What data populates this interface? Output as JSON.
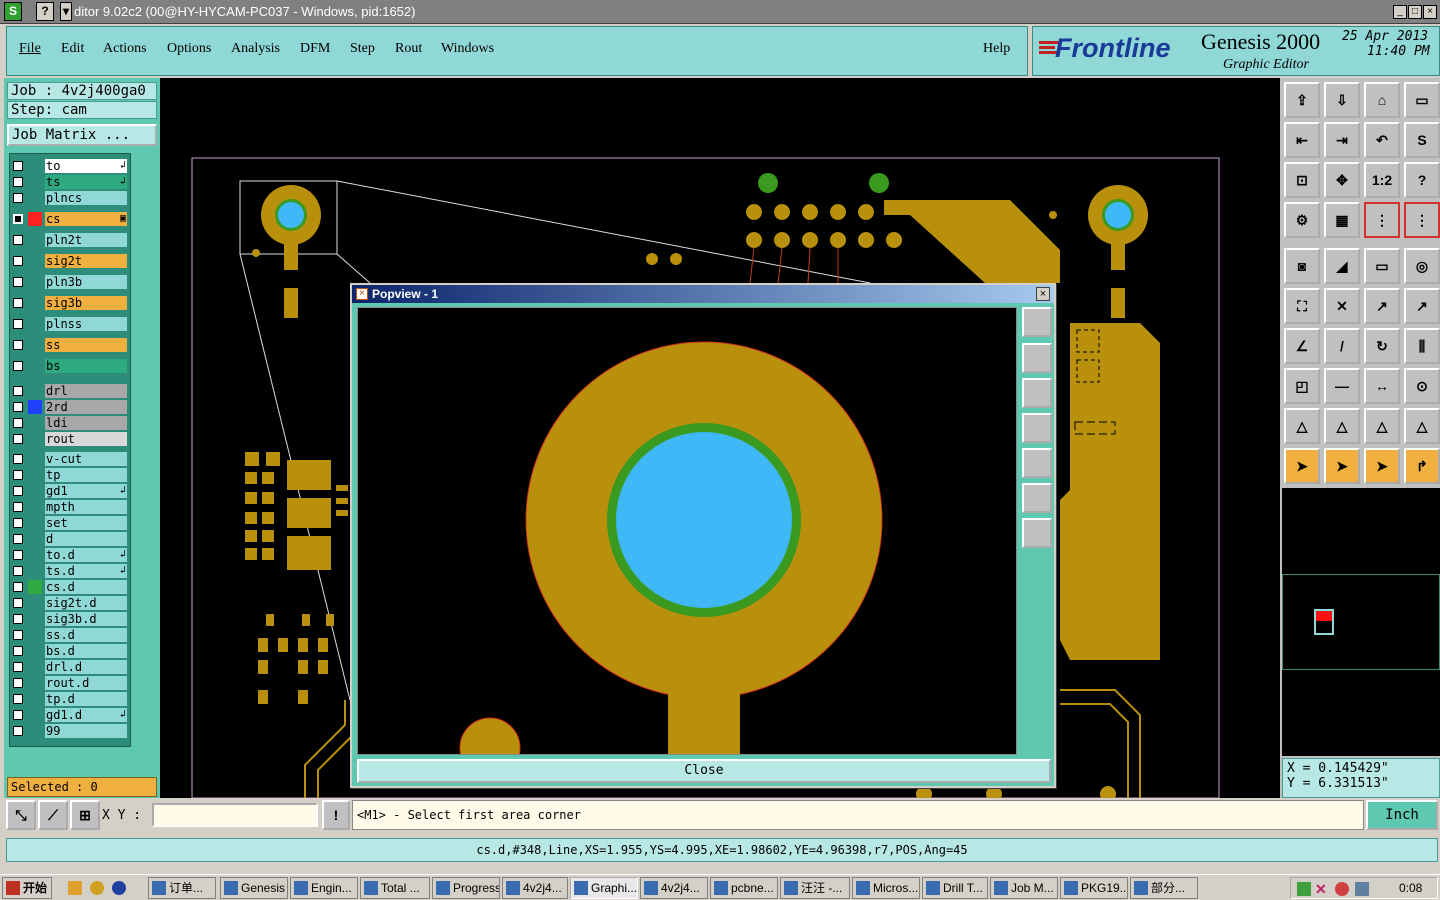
{
  "window": {
    "title": "ditor 9.02c2 (00@HY-HYCAM-PC037 - Windows, pid:1652)",
    "icon_s": "S",
    "icon_q": "?",
    "min": "_",
    "max": "□",
    "close": "×"
  },
  "menu": [
    "File",
    "Edit",
    "Actions",
    "Options",
    "Analysis",
    "DFM",
    "Step",
    "Rout",
    "Windows"
  ],
  "help": "Help",
  "brand": {
    "logo": "Frontline",
    "product": "Genesis 2000",
    "sub": "Graphic Editor",
    "date": "25 Apr 2013",
    "time": "11:40 PM"
  },
  "job": {
    "job": "Job : 4v2j400ga0",
    "step": "Step: cam",
    "matrix": "Job Matrix ..."
  },
  "layers": [
    {
      "name": "to",
      "bg": "#ffffff",
      "sw": "",
      "mark": "↲"
    },
    {
      "name": "ts",
      "bg": "#2eaa80",
      "sw": "",
      "mark": "↲"
    },
    {
      "name": "plncs",
      "bg": "#8fd8d6",
      "sw": ""
    },
    {
      "name": "cs",
      "bg": "#f0b040",
      "sw": "#ff2020",
      "mark": "▣",
      "sel": true
    },
    {
      "name": "pln2t",
      "bg": "#8fd8d6",
      "sw": ""
    },
    {
      "name": "sig2t",
      "bg": "#f0b040",
      "sw": ""
    },
    {
      "name": "pln3b",
      "bg": "#8fd8d6",
      "sw": ""
    },
    {
      "name": "sig3b",
      "bg": "#f0b040",
      "sw": ""
    },
    {
      "name": "plnss",
      "bg": "#8fd8d6",
      "sw": ""
    },
    {
      "name": "ss",
      "bg": "#f0b040",
      "sw": ""
    },
    {
      "name": "bs",
      "bg": "#2eaa80",
      "sw": ""
    },
    {
      "name": "drl",
      "bg": "#a8a8a8",
      "sw": ""
    },
    {
      "name": "2rd",
      "bg": "#a8a8a8",
      "sw": "#2040ff"
    },
    {
      "name": "ldi",
      "bg": "#a8a8a8",
      "sw": ""
    },
    {
      "name": "rout",
      "bg": "#d8d8d8",
      "sw": ""
    },
    {
      "name": "v-cut",
      "bg": "#8fd8d6",
      "sw": ""
    },
    {
      "name": "tp",
      "bg": "#8fd8d6",
      "sw": ""
    },
    {
      "name": "gd1",
      "bg": "#8fd8d6",
      "sw": "",
      "mark": "↲"
    },
    {
      "name": "mpth",
      "bg": "#8fd8d6",
      "sw": ""
    },
    {
      "name": "set",
      "bg": "#8fd8d6",
      "sw": ""
    },
    {
      "name": "d",
      "bg": "#8fd8d6",
      "sw": ""
    },
    {
      "name": "to.d",
      "bg": "#8fd8d6",
      "sw": "",
      "mark": "↲"
    },
    {
      "name": "ts.d",
      "bg": "#8fd8d6",
      "sw": "",
      "mark": "↲"
    },
    {
      "name": "cs.d",
      "bg": "#8fd8d6",
      "sw": "#2eaa40"
    },
    {
      "name": "sig2t.d",
      "bg": "#8fd8d6",
      "sw": ""
    },
    {
      "name": "sig3b.d",
      "bg": "#8fd8d6",
      "sw": ""
    },
    {
      "name": "ss.d",
      "bg": "#8fd8d6",
      "sw": ""
    },
    {
      "name": "bs.d",
      "bg": "#8fd8d6",
      "sw": ""
    },
    {
      "name": "drl.d",
      "bg": "#8fd8d6",
      "sw": ""
    },
    {
      "name": "rout.d",
      "bg": "#8fd8d6",
      "sw": ""
    },
    {
      "name": "tp.d",
      "bg": "#8fd8d6",
      "sw": ""
    },
    {
      "name": "gd1.d",
      "bg": "#8fd8d6",
      "sw": "",
      "mark": "↲"
    },
    {
      "name": "99",
      "bg": "#8fd8d6",
      "sw": ""
    }
  ],
  "selected": "Selected : 0",
  "popview": {
    "title": "Popview - 1",
    "close_btn": "Close",
    "close_x": "×"
  },
  "coords": {
    "x": "X = 0.145429\"",
    "y": "Y = 6.331513\""
  },
  "cmd": {
    "xy_label": "X Y :",
    "prompt": "<M1> - Select first area corner",
    "unit": "Inch",
    "bang": "!"
  },
  "status": "cs.d,#348,Line,XS=1.955,YS=4.995,XE=1.98602,YE=4.96398,r7,POS,Ang=45",
  "taskbar": {
    "start": "开始",
    "clock": "0:08",
    "tasks": [
      "订单...",
      "Genesis",
      "Engin...",
      "Total ...",
      "Progress",
      "4v2j4...",
      "Graphi...",
      "4v2j4...",
      "pcbne...",
      "汪汪 -...",
      "Micros...",
      "Drill T...",
      "Job M...",
      "PKG19...",
      "部分..."
    ]
  },
  "colors": {
    "cyan": "#8fd8d6",
    "copper": "#b8900c",
    "hole": "#40b8f8",
    "ring": "#3a9a20",
    "canvas": "#000000"
  }
}
